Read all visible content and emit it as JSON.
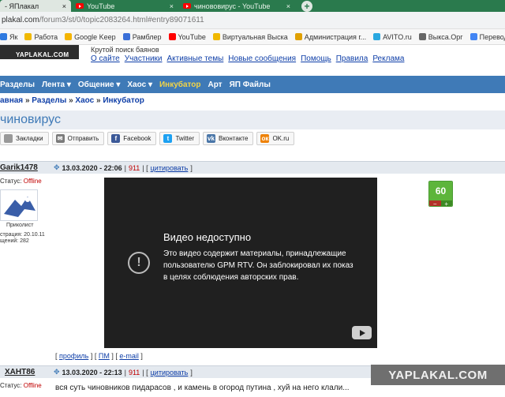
{
  "browser": {
    "tabs": [
      {
        "title": "- ЯПлакал",
        "active": true
      },
      {
        "title": "YouTube",
        "active": false
      },
      {
        "title": "чинововирус - YouTube",
        "active": false
      }
    ],
    "tab_close_icon": "×",
    "new_tab_icon": "+",
    "url_main": "plakal.com",
    "url_rest": "/forum3/st/0/topic2083264.html#entry89071611",
    "bookmarks": [
      {
        "label": "Як",
        "color": "#2f7ae0"
      },
      {
        "label": "Работа",
        "color": "#f0b800"
      },
      {
        "label": "Google Keep",
        "color": "#f4b400"
      },
      {
        "label": "Рамблер",
        "color": "#3a6fd8"
      },
      {
        "label": "YouTube",
        "color": "#ff0000"
      },
      {
        "label": "Виртуальная Выска",
        "color": "#f0b800"
      },
      {
        "label": "Администрация г...",
        "color": "#e0a000"
      },
      {
        "label": "AVITO.ru",
        "color": "#2aa8e0"
      },
      {
        "label": "Выкса.Орг",
        "color": "#666666"
      },
      {
        "label": "Переводчик Google",
        "color": "#4285f4"
      }
    ]
  },
  "site": {
    "logo_text": "YAPLAKAL.COM",
    "tagline": "Крутой поиск баянов",
    "nav": [
      "О сайте",
      "Участники",
      "Активные темы",
      "Новые сообщения",
      "Помощь",
      "Правила",
      "Реклама"
    ],
    "menu": [
      {
        "label": "Разделы",
        "highlight": false
      },
      {
        "label": "Лента ▾",
        "highlight": false
      },
      {
        "label": "Общение ▾",
        "highlight": false
      },
      {
        "label": "Хаос ▾",
        "highlight": false
      },
      {
        "label": "Инкубатор",
        "highlight": true
      },
      {
        "label": "Арт",
        "highlight": false
      },
      {
        "label": "ЯП Файлы",
        "highlight": false
      }
    ],
    "breadcrumb": [
      "авная",
      "Разделы",
      "Хаос",
      "Инкубатор"
    ],
    "breadcrumb_sep": "»",
    "topic_title": "чиновирус"
  },
  "share": [
    {
      "label": "Закладки",
      "icon": "bookmark-icon",
      "color": "#999999",
      "glyph": ""
    },
    {
      "label": "Отправить",
      "icon": "mail-icon",
      "color": "#7a7a7a",
      "glyph": "✉"
    },
    {
      "label": "Facebook",
      "icon": "facebook-icon",
      "color": "#3b5998",
      "glyph": "f"
    },
    {
      "label": "Twitter",
      "icon": "twitter-icon",
      "color": "#1da1f2",
      "glyph": "t"
    },
    {
      "label": "Вконтакте",
      "icon": "vk-icon",
      "color": "#4a76a8",
      "glyph": "vk"
    },
    {
      "label": "OK.ru",
      "icon": "ok-icon",
      "color": "#ee8208",
      "glyph": "ок"
    }
  ],
  "posts": [
    {
      "author": "Garik1478",
      "date": "13.03.2020 - 22:06",
      "num": "911",
      "quote": "цитировать",
      "status_label": "Статус:",
      "status": "Offline",
      "rank": "Приколист",
      "reg": "страция: 20.10.11",
      "msgs": "щений: 282",
      "video_title": "Видео недоступно",
      "video_desc": "Это видео содержит материалы, принадлежащие пользователю GPM RTV. Он заблокировал их показ в целях соблюдения авторских прав.",
      "rating": "60",
      "rating_minus": "−",
      "rating_plus": "+",
      "links": [
        "профиль",
        "ПМ",
        "e-mail"
      ]
    },
    {
      "author": "ХАНТ86",
      "date": "13.03.2020 - 22:13",
      "num": "911",
      "quote": "цитировать",
      "status_label": "Статус:",
      "status": "Offline",
      "text": "вся суть чиновников пидарасов , и камень в огород путина , хуй на него клали..."
    }
  ],
  "watermark": "YAPLAKAL.COM"
}
